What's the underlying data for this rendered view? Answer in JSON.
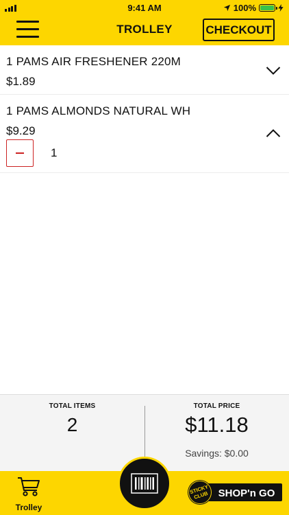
{
  "status_bar": {
    "time": "9:41 AM",
    "battery": "100%",
    "battery_level": 1.0,
    "battery_color": "#39c24a"
  },
  "header": {
    "title": "TROLLEY",
    "checkout_label": "CHECKOUT",
    "background": "#fdd600"
  },
  "items": [
    {
      "name": "1 PAMS AIR FRESHENER 220M",
      "price": "$1.89",
      "expanded": false,
      "chevron_icon": "chevron-down-icon"
    },
    {
      "name": "1 PAMS ALMONDS NATURAL WH",
      "price": "$9.29",
      "expanded": true,
      "chevron_icon": "chevron-up-icon",
      "quantity": "1",
      "minus_icon": "minus-icon",
      "minus_color": "#cc2222"
    }
  ],
  "totals": {
    "items_label": "TOTAL ITEMS",
    "items_value": "2",
    "price_label": "TOTAL PRICE",
    "price_value": "$11.18",
    "savings": "Savings: $0.00"
  },
  "bottom_bar": {
    "trolley_label": "Trolley",
    "trolley_icon": "cart-icon",
    "scan_icon": "barcode-icon",
    "brand": {
      "badge_line1": "STICKY",
      "badge_line2": "CLUB",
      "wordmark": "SHOP'n GO"
    }
  }
}
